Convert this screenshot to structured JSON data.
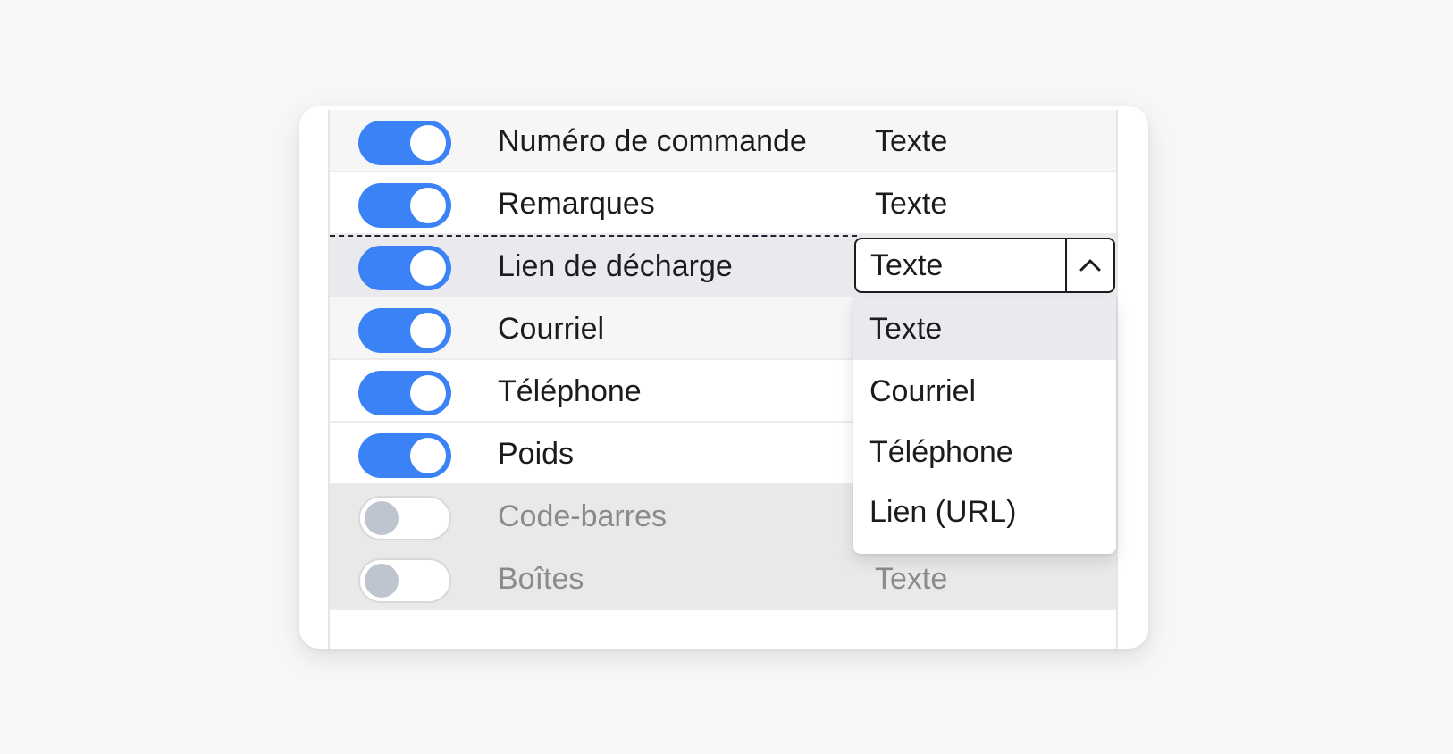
{
  "rows": [
    {
      "enabled": true,
      "label": "Numéro de commande",
      "type": "Texte"
    },
    {
      "enabled": true,
      "label": "Remarques",
      "type": "Texte"
    },
    {
      "enabled": true,
      "label": "Lien de décharge",
      "type": "Texte"
    },
    {
      "enabled": true,
      "label": "Courriel",
      "type": ""
    },
    {
      "enabled": true,
      "label": "Téléphone",
      "type": ""
    },
    {
      "enabled": true,
      "label": "Poids",
      "type": ""
    },
    {
      "enabled": false,
      "label": "Code-barres",
      "type": ""
    },
    {
      "enabled": false,
      "label": "Boîtes",
      "type": "Texte"
    }
  ],
  "type_select": {
    "value": "Texte",
    "icon": "chevron-up-icon",
    "options": [
      "Texte",
      "Courriel",
      "Téléphone",
      "Lien (URL)"
    ],
    "highlighted": "Texte"
  },
  "colors": {
    "accent": "#3b82f6",
    "toggle_off_knob": "#bfc5cf",
    "disabled_text": "#8b8b8f"
  }
}
